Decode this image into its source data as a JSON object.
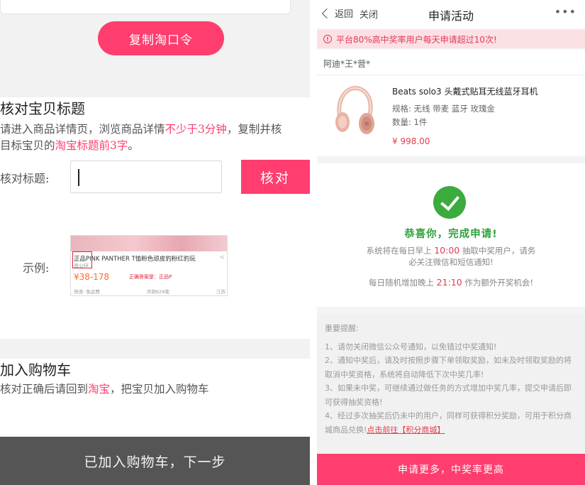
{
  "left": {
    "copy_button": "复制淘口令",
    "section1": {
      "title": "核对宝贝标题",
      "desc_line1_a": "请进入商品详情页，浏览商品详情",
      "desc_line1_b": "不少于3分钟",
      "desc_line1_c": "，复制并核",
      "desc_line2_a": "目标宝贝的",
      "desc_line2_b": "淘宝标题前3字",
      "desc_line2_c": "。",
      "verify_label": "核对标题:",
      "verify_input_value": "",
      "verify_button": "核对",
      "example_label": "示例:",
      "example": {
        "title": "正品PINK PANTHER T恤粉色顽皮豹粉红豹玩",
        "sub": "具公仔",
        "price": "¥38-178",
        "note": "正确答案是：正品P",
        "foot_left": "快递: 免运费",
        "foot_mid": "月销629笔",
        "foot_right": "江苏"
      }
    },
    "section2": {
      "title": "加入购物车",
      "desc_a": "核对正确后请回到",
      "desc_b": "淘宝",
      "desc_c": "，把宝贝加入购物车"
    },
    "next_button": "已加入购物车，下一步"
  },
  "right": {
    "nav": {
      "back": "返回",
      "close": "关闭",
      "title": "申请活动",
      "more": "•••"
    },
    "notice": "平台80%高中奖率用户每天申请超过10次!",
    "user": "阿迪*王*营*",
    "product": {
      "name": "Beats solo3 头戴式贴耳无线蓝牙耳机",
      "spec": "规格: 无线 带麦 蓝牙 玫瑰金",
      "qty": "数量: 1件",
      "price": "¥ 998.00"
    },
    "success": {
      "title": "恭喜你，完成申请!",
      "line1_a": "系统将在每日早上 ",
      "line1_time": "10:00",
      "line1_b": " 抽取中奖用户，请务",
      "line2": "必关注微信和短信通知!",
      "line3_a": "每日随机增加晚上 ",
      "line3_time": "21:10",
      "line3_b": " 作为额外开奖机会!"
    },
    "tips": {
      "title": "重要提醒:",
      "items": [
        "1、请勿关闭微信公众号通知，以免错过中奖通知!",
        "2、通知中奖后，请及时按照步骤下单领取奖励，如未及时领取奖励的将取消中奖资格，系统将自动降低下次中奖几率!",
        "3、如果未中奖，可继续通过做任务的方式增加中奖几率，提交申请后即可获得抽奖资格!",
        "4、经过多次抽奖后仍未中的用户，同样可获得积分奖励，可用于积分商城商品兑换!"
      ],
      "link": "点击前往【积分商城】"
    },
    "cta": "申请更多，中奖率更高"
  },
  "colors": {
    "accent": "#ff3d6e",
    "success": "#3bab3e",
    "price": "#e63c4c"
  }
}
